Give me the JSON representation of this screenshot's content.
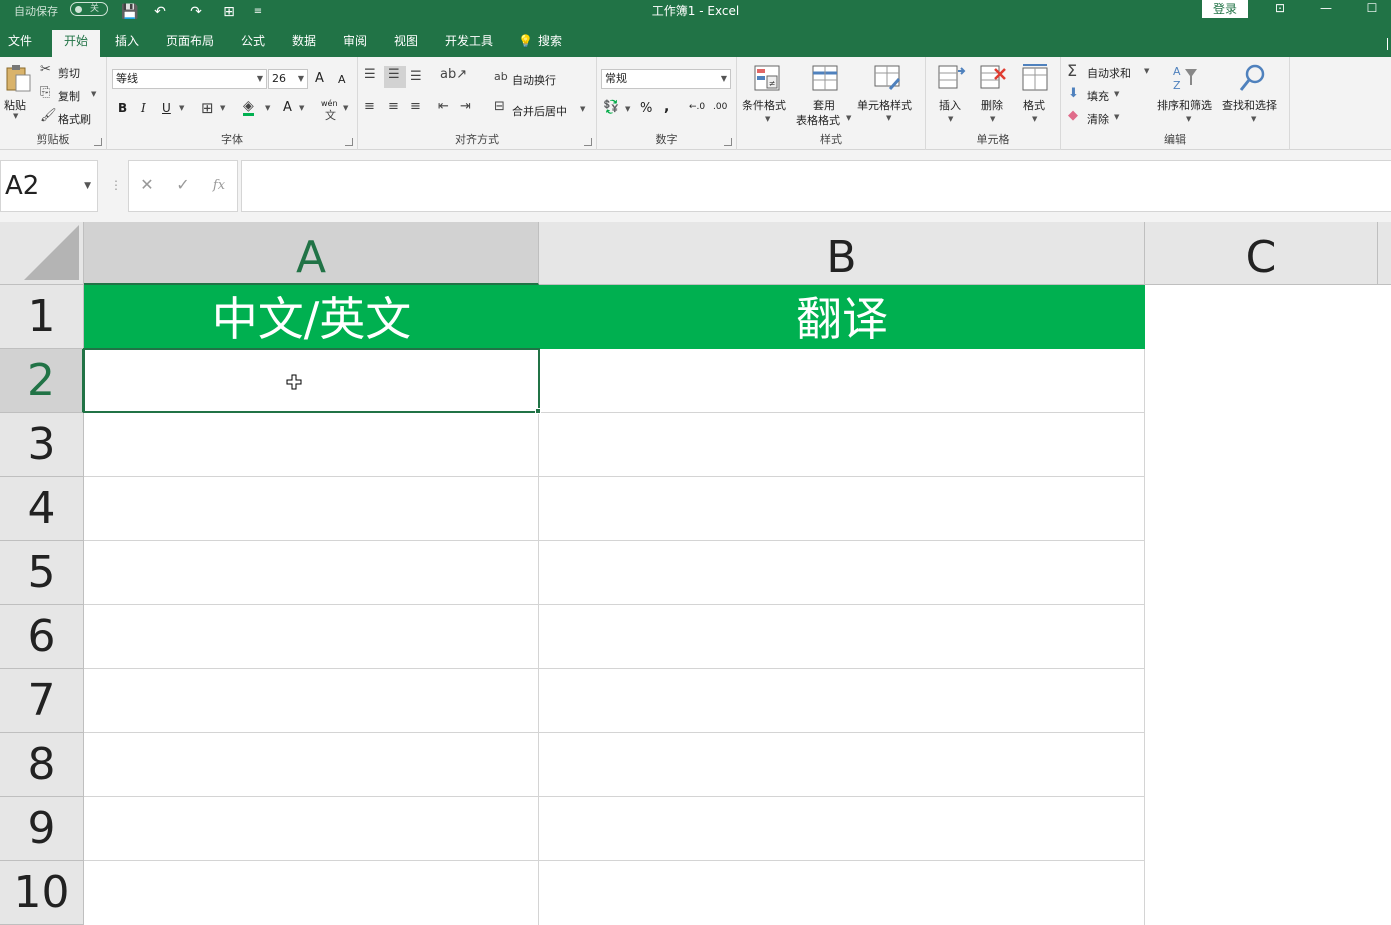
{
  "titlebar": {
    "autosave_label": "自动保存",
    "autosave_state": "关",
    "title": "工作簿1  -  Excel",
    "login": "登录",
    "qa_save": "💾",
    "qa_undo": "↶",
    "qa_redo": "↷",
    "qa_custom": "⊞",
    "qa_more": "≡"
  },
  "menu": {
    "tabs": [
      "文件",
      "开始",
      "插入",
      "页面布局",
      "公式",
      "数据",
      "审阅",
      "视图",
      "开发工具",
      "搜索"
    ],
    "active": "开始"
  },
  "ribbon": {
    "clipboard": {
      "paste": "粘贴",
      "cut": "剪切",
      "copy": "复制",
      "format_painter": "格式刷",
      "label": "剪贴板"
    },
    "font": {
      "name": "等线",
      "size": "26",
      "bold": "B",
      "italic": "I",
      "underline": "U",
      "grow": "A",
      "shrink": "A",
      "font_color": "A",
      "phonetic": "wén",
      "label": "字体"
    },
    "alignment": {
      "wrap": "自动换行",
      "merge": "合并后居中",
      "label": "对齐方式"
    },
    "number": {
      "format": "常规",
      "percent": "%",
      "comma": ",",
      "inc": "←.0",
      "dec": ".00",
      "label": "数字"
    },
    "styles": {
      "conditional": "条件格式",
      "table_l1": "套用",
      "table_l2": "表格格式",
      "cell_styles": "单元格样式",
      "label": "样式"
    },
    "cells": {
      "insert": "插入",
      "delete": "删除",
      "format": "格式",
      "label": "单元格"
    },
    "editing": {
      "autosum": "自动求和",
      "fill": "填充",
      "clear": "清除",
      "sort": "排序和筛选",
      "find": "查找和选择",
      "label": "编辑"
    }
  },
  "formula_bar": {
    "name_box": "A2",
    "cancel": "✕",
    "enter": "✓",
    "fx": "fx",
    "content": ""
  },
  "sheet": {
    "columns": [
      "A",
      "B",
      "C"
    ],
    "rows": [
      "1",
      "2",
      "3",
      "4",
      "5",
      "6",
      "7",
      "8",
      "9",
      "10"
    ],
    "selected_cell": "A2",
    "header_fill": "#00b050",
    "cells": {
      "A1": "中文/英文",
      "B1": "翻译"
    }
  }
}
